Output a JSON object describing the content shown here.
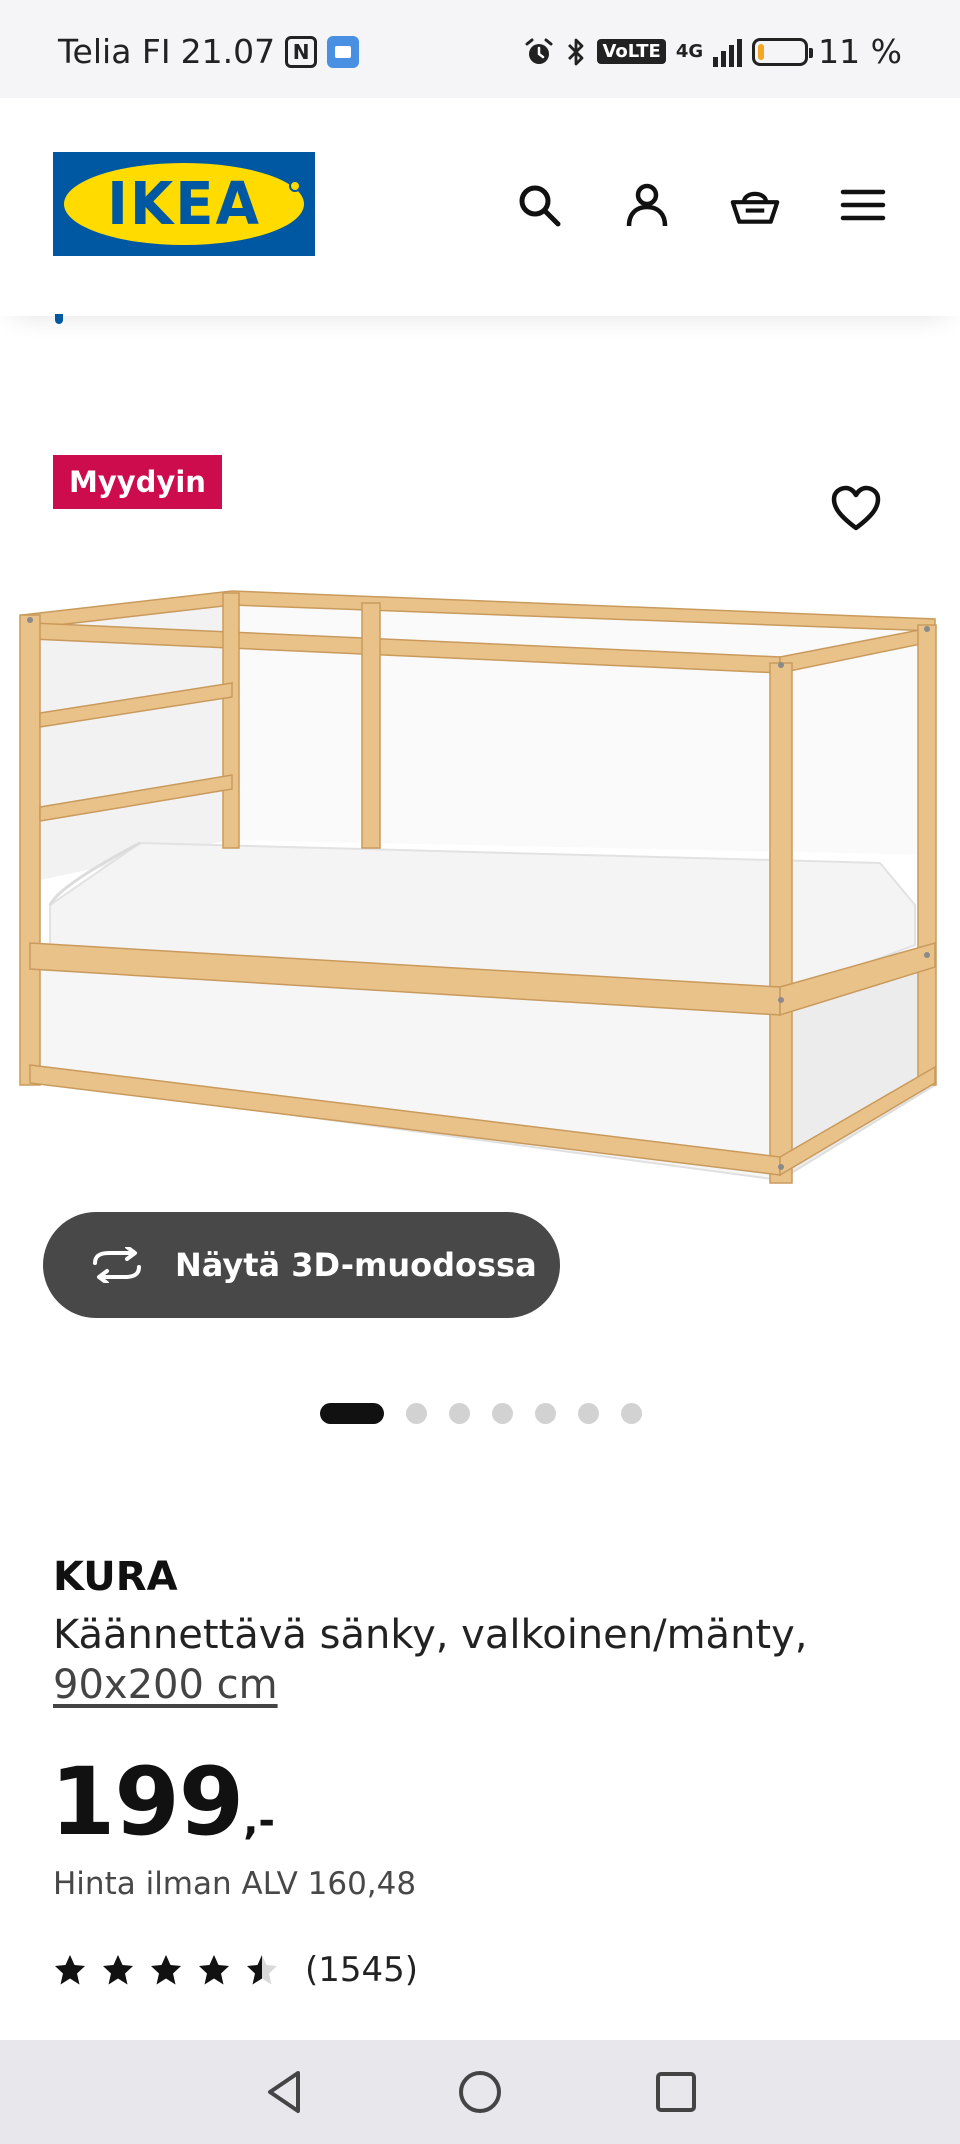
{
  "status_bar": {
    "carrier": "Telia FI",
    "time": "21.07",
    "nfc_label": "N",
    "volte": "VoLTE",
    "network": "4G",
    "battery_level": 0.11,
    "battery_text": "11 %",
    "battery_color": "#f5a623"
  },
  "header": {
    "logo_text": "IKEA",
    "brand_blue": "#0058a3",
    "brand_yellow": "#ffdb00",
    "icons": [
      "search-icon",
      "user-icon",
      "basket-icon",
      "menu-icon"
    ]
  },
  "product": {
    "badge": "Myydyin",
    "badge_color": "#cc0c4d",
    "favorite_icon": "heart-icon",
    "view_3d_label": "Näytä 3D-muodossa",
    "carousel": {
      "count": 7,
      "active": 0
    },
    "name": "KURA",
    "description": "Käännettävä sänky, valkoinen/mänty,",
    "size": "90x200 cm",
    "price_integer": "199",
    "price_suffix": ",-",
    "vat_text": "Hinta ilman ALV 160,48",
    "rating": 4.5,
    "rating_max": 5,
    "review_count": "(1545)"
  },
  "navbar": {
    "buttons": [
      "back-icon",
      "home-icon",
      "recents-icon"
    ]
  }
}
